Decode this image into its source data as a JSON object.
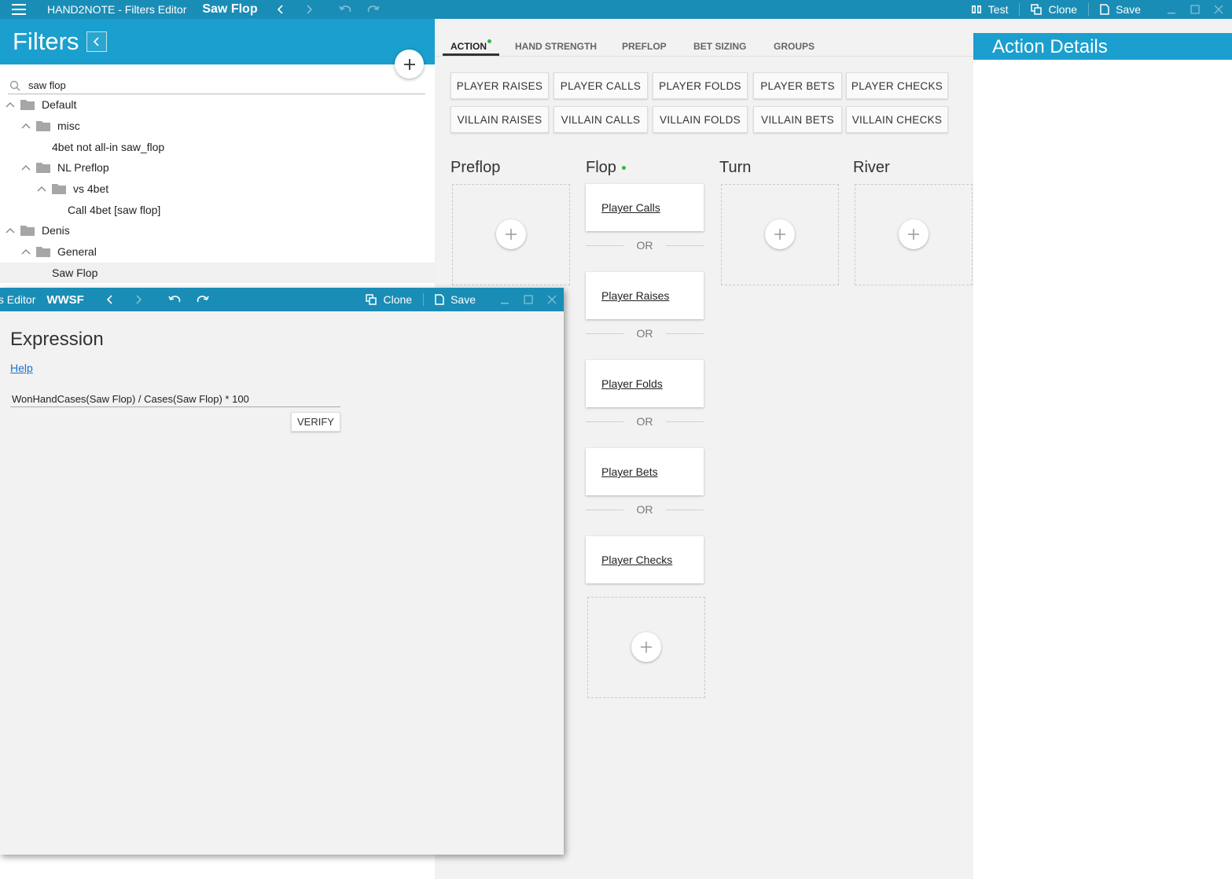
{
  "titlebar": {
    "app_title": "HAND2NOTE - Filters Editor",
    "filter_name": "Saw Flop",
    "test_label": "Test",
    "clone_label": "Clone",
    "save_label": "Save"
  },
  "filters": {
    "title": "Filters",
    "search_value": "saw flop",
    "tree": [
      {
        "label": "Default",
        "level": 0,
        "type": "folder"
      },
      {
        "label": "misc",
        "level": 1,
        "type": "folder"
      },
      {
        "label": "4bet not all-in saw_flop",
        "level": 2,
        "type": "item"
      },
      {
        "label": "NL Preflop",
        "level": 1,
        "type": "folder"
      },
      {
        "label": "vs 4bet",
        "level": 2,
        "type": "folder"
      },
      {
        "label": "Call 4bet [saw flop]",
        "level": 3,
        "type": "item"
      },
      {
        "label": "Denis",
        "level": 0,
        "type": "folder"
      },
      {
        "label": "General",
        "level": 1,
        "type": "folder"
      },
      {
        "label": "Saw Flop",
        "level": 2,
        "type": "item",
        "selected": true
      }
    ]
  },
  "center": {
    "tabs": [
      "ACTION",
      "HAND STRENGTH",
      "PREFLOP",
      "BET SIZING",
      "GROUPS"
    ],
    "active_tab": "ACTION",
    "player_actions": [
      "PLAYER RAISES",
      "PLAYER CALLS",
      "PLAYER FOLDS",
      "PLAYER BETS",
      "PLAYER CHECKS"
    ],
    "villain_actions": [
      "VILLAIN RAISES",
      "VILLAIN CALLS",
      "VILLAIN FOLDS",
      "VILLAIN BETS",
      "VILLAIN CHECKS"
    ],
    "streets": [
      "Preflop",
      "Flop",
      "Turn",
      "River"
    ],
    "flop_cards": [
      "Player Calls",
      "Player Raises",
      "Player Folds",
      "Player Bets",
      "Player Checks"
    ],
    "or_label": "OR"
  },
  "right": {
    "title": "Action Details"
  },
  "float_window": {
    "app_title": "ts Editor",
    "name": "WWSF",
    "clone_label": "Clone",
    "save_label": "Save",
    "heading": "Expression",
    "help_label": "Help",
    "expression": "WonHandCases(Saw Flop) / Cases(Saw Flop) * 100",
    "verify_label": "VERIFY"
  },
  "colors": {
    "titlebar": "#1a8db6",
    "panel_header": "#1a9fce",
    "active_dot": "#2db84d"
  }
}
